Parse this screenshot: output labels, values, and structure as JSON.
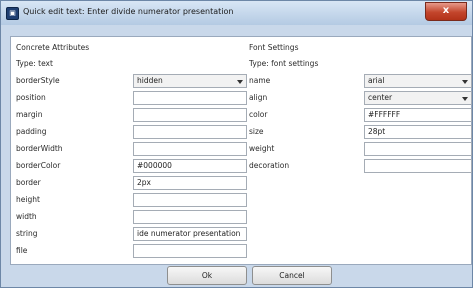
{
  "window": {
    "title": "Quick edit text: Enter divide numerator presentation",
    "close_icon": "close-icon",
    "close_label": "x"
  },
  "concrete": {
    "title": "Concrete Attributes",
    "type_label": "Type: text",
    "rows": [
      {
        "label": "borderStyle",
        "value": "hidden"
      },
      {
        "label": "position",
        "value": ""
      },
      {
        "label": "margin",
        "value": ""
      },
      {
        "label": "padding",
        "value": ""
      },
      {
        "label": "borderWidth",
        "value": ""
      },
      {
        "label": "borderColor",
        "value": "#000000"
      },
      {
        "label": "border",
        "value": "2px"
      },
      {
        "label": "height",
        "value": ""
      },
      {
        "label": "width",
        "value": ""
      },
      {
        "label": "string",
        "value": "ide numerator presentation"
      },
      {
        "label": "file",
        "value": ""
      }
    ]
  },
  "font": {
    "title": "Font Settings",
    "type_label": "Type: font settings",
    "rows": [
      {
        "label": "name",
        "value": "arial"
      },
      {
        "label": "align",
        "value": "center"
      },
      {
        "label": "color",
        "value": "#FFFFFF"
      },
      {
        "label": "size",
        "value": "28pt"
      },
      {
        "label": "weight",
        "value": ""
      },
      {
        "label": "decoration",
        "value": ""
      }
    ]
  },
  "buttons": {
    "ok": "Ok",
    "cancel": "Cancel"
  }
}
